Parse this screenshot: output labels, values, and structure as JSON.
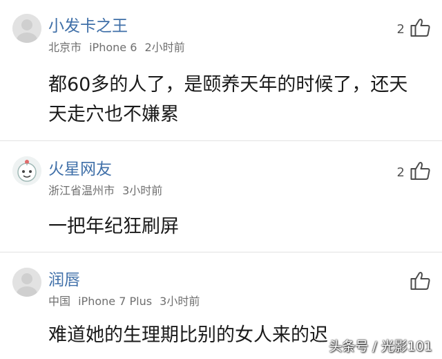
{
  "comments": [
    {
      "username": "小发卡之王",
      "location": "北京市",
      "device": "iPhone 6",
      "time": "2小时前",
      "text": "都60多的人了，是颐养天年的时候了，还天天走穴也不嫌累",
      "likes": "2",
      "avatar": "default-avatar"
    },
    {
      "username": "火星网友",
      "location": "浙江省温州市",
      "device": "",
      "time": "3小时前",
      "text": "一把年纪狂刷屏",
      "likes": "2",
      "avatar": "mascot-avatar"
    },
    {
      "username": "润唇",
      "location": "中国",
      "device": "iPhone 7 Plus",
      "time": "3小时前",
      "text": "难道她的生理期比别的女人来的迟",
      "likes": "",
      "avatar": "default-avatar"
    }
  ],
  "watermark": "头条号 / 光影101",
  "icons": {
    "like": "thumbs-up-icon"
  },
  "colors": {
    "username": "#3f6fa8",
    "meta": "#6f6f6f",
    "text": "#1a1a1a"
  }
}
